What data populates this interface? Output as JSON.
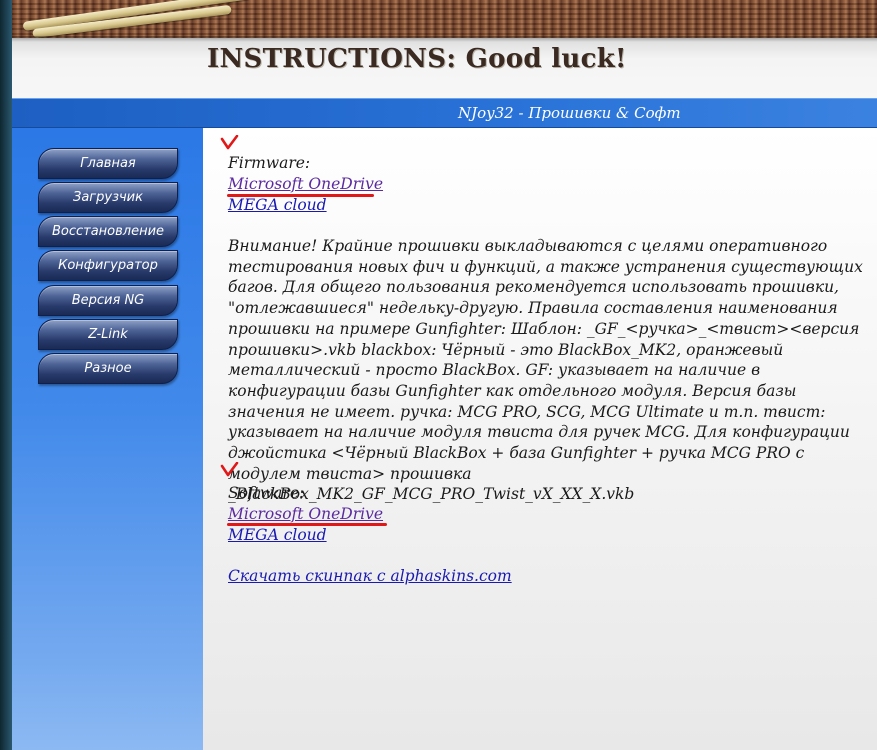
{
  "header": {
    "banner_title": "INSTRUCTIONS: Good luck!",
    "site_title": "NJoy32 - Прошивки & Софт"
  },
  "sidebar": {
    "items": [
      {
        "label": "Главная"
      },
      {
        "label": "Загрузчик"
      },
      {
        "label": "Восстановление"
      },
      {
        "label": "Конфигуратор"
      },
      {
        "label": "Версия NG"
      },
      {
        "label": "Z-Link"
      },
      {
        "label": "Разное"
      }
    ]
  },
  "main": {
    "firmware_label": "Firmware:",
    "firmware_links": [
      "Microsoft OneDrive",
      "MEGA cloud"
    ],
    "notice": "Внимание! Крайние прошивки выкладываются с целями оперативного тестирования новых фич и функций, а также устранения существующих багов. Для общего пользования рекомендуется использовать прошивки, \"отлежавшиеся\" недельку-другую. Правила составления наименования прошивки на примере Gunfighter: Шаблон: _GF_<ручка>_<твист><версия прошивки>.vkb blackbox: Чёрный - это BlackBox_MK2, оранжевый металлический - просто BlackBox. GF: указывает на наличие в конфигурации базы Gunfighter как отдельного модуля. Версия базы значения не имеет. ручка: MCG PRO, SCG, MCG Ultimate и т.п. твист: указывает на наличие модуля твиста для ручек MCG. Для конфигурации джойстика <Чёрный BlackBox + база Gunfighter + ручка MCG PRO с модулем твиста> прошивка _BlackBox_MK2_GF_MCG_PRO_Twist_vX_XX_X.vkb",
    "software_label": "Software:",
    "software_links": [
      "Microsoft OneDrive",
      "MEGA cloud"
    ],
    "skinpack_link": "Скачать скинпак с alphaskins.com"
  },
  "colors": {
    "accent_blue": "#2a73d8",
    "annotation_red": "#e01818",
    "link_blue": "#1a1ab0",
    "link_visited": "#5b2aa0"
  }
}
